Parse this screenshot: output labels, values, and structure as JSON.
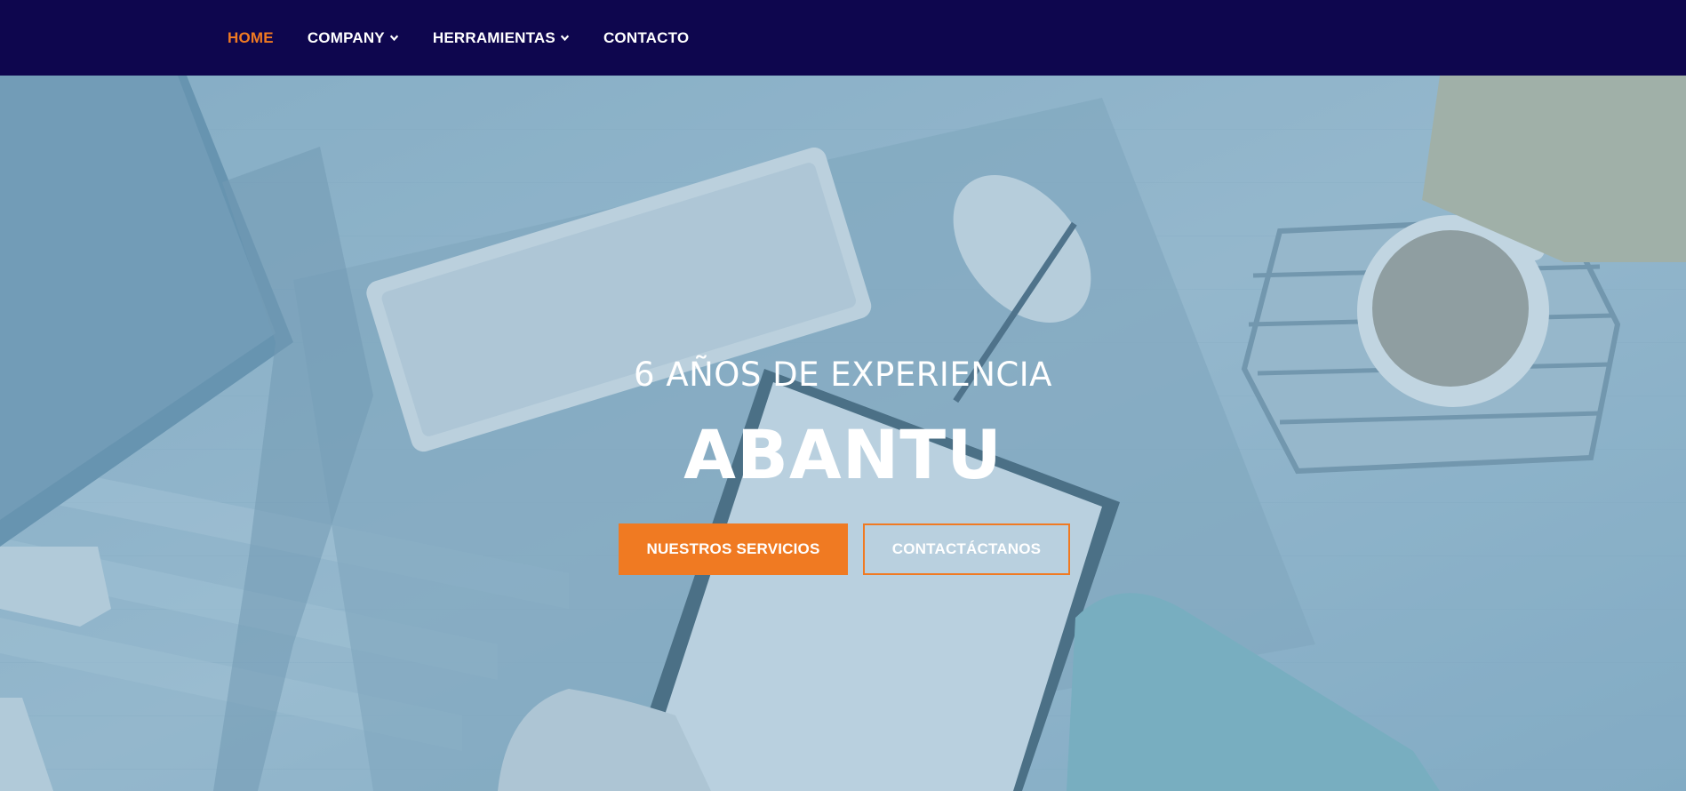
{
  "nav": {
    "items": [
      {
        "label": "HOME",
        "active": true,
        "has_dropdown": false
      },
      {
        "label": "COMPANY",
        "active": false,
        "has_dropdown": true
      },
      {
        "label": "HERRAMIENTAS",
        "active": false,
        "has_dropdown": true
      },
      {
        "label": "CONTACTO",
        "active": false,
        "has_dropdown": false
      }
    ]
  },
  "hero": {
    "subtitle": "6 AÑOS DE EXPERIENCIA",
    "title": "ABANTU",
    "primary_button": "NUESTROS SERVICIOS",
    "secondary_button": "CONTACTÁCTANOS"
  },
  "colors": {
    "navbar_bg": "#0e064e",
    "accent": "#f07a22",
    "text": "#ffffff"
  }
}
